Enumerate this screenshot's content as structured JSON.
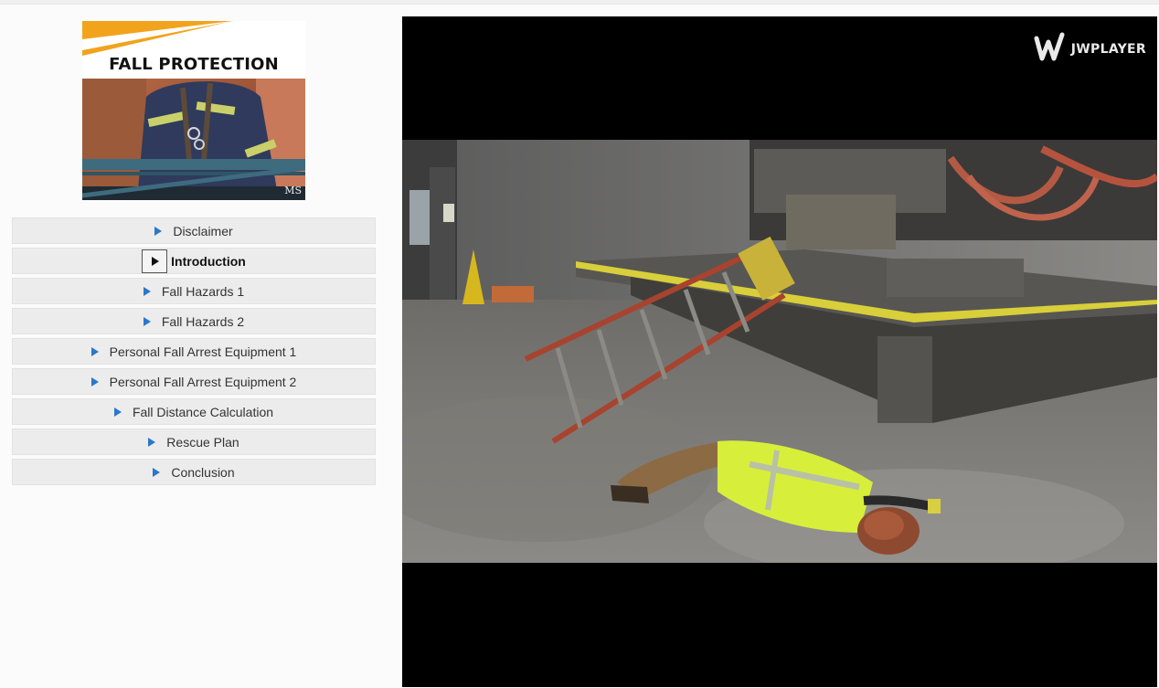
{
  "course": {
    "title": "FALL PROTECTION",
    "logo_mark": "MS"
  },
  "menu": {
    "items": [
      {
        "label": "Disclaimer",
        "active": false
      },
      {
        "label": "Introduction",
        "active": true
      },
      {
        "label": "Fall Hazards 1",
        "active": false
      },
      {
        "label": "Fall Hazards 2",
        "active": false
      },
      {
        "label": "Personal Fall Arrest Equipment 1",
        "active": false
      },
      {
        "label": "Personal Fall Arrest Equipment 2",
        "active": false
      },
      {
        "label": "Fall Distance Calculation",
        "active": false
      },
      {
        "label": "Rescue Plan",
        "active": false
      },
      {
        "label": "Conclusion",
        "active": false
      }
    ]
  },
  "player": {
    "brand_label": "JWPLAYER",
    "video_subject": "worker-lying-beside-fallen-ladder"
  },
  "colors": {
    "accent_orange": "#f2a31c",
    "menu_arrow_blue": "#2a78c8",
    "menu_bg": "#ececec",
    "player_bg": "#000000"
  },
  "icons": {
    "menu_arrow": "play-triangle-icon",
    "player_logo": "jwplayer-logo-icon"
  }
}
